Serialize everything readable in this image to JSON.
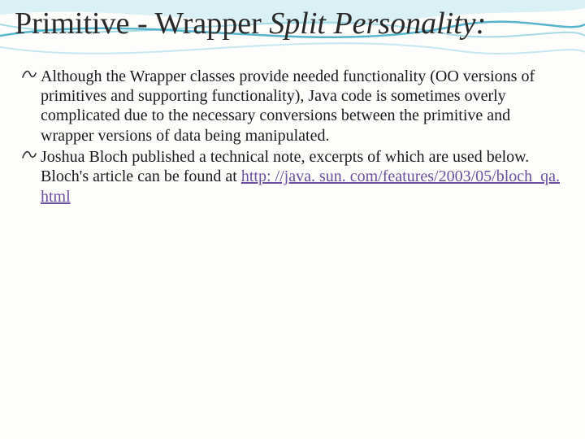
{
  "title": {
    "part1": "Primitive - Wrapper ",
    "part2": "Split Personality:"
  },
  "bullets": [
    {
      "text": "Although the Wrapper classes provide needed functionality (OO versions of primitives and supporting functionality), Java code is sometimes overly complicated due to the necessary conversions between the primitive and wrapper versions of data being manipulated."
    },
    {
      "prefix": "Joshua Bloch published a technical note, excerpts of which are used below. Bloch's article can be found at ",
      "link": "http: //java. sun. com/features/2003/05/bloch_qa. html"
    }
  ],
  "marker": "➢"
}
